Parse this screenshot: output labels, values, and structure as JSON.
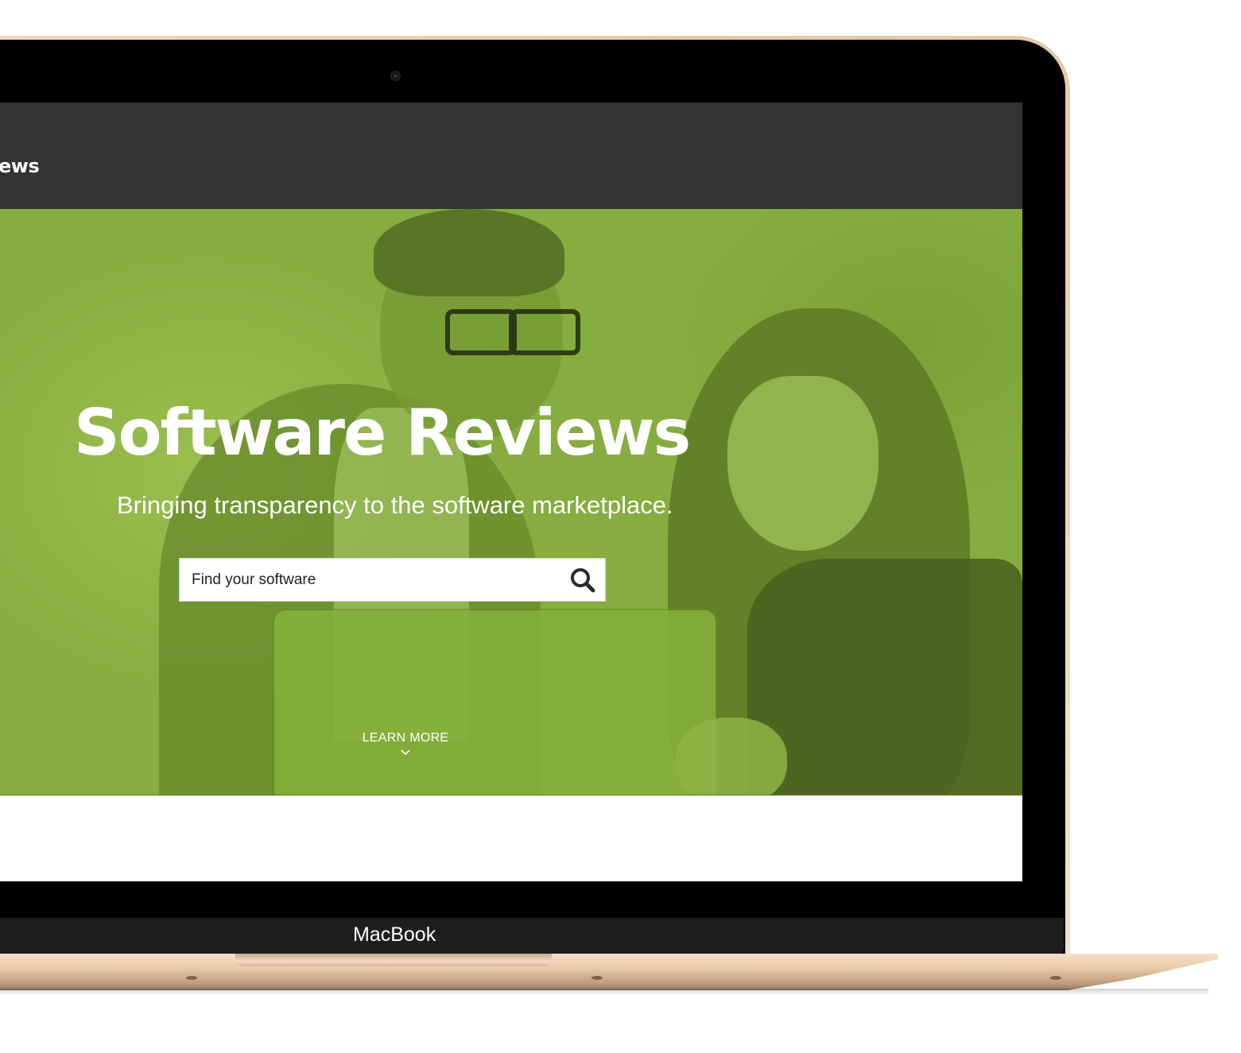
{
  "device": {
    "label": "MacBook"
  },
  "site_header": {
    "brand_fragment": "ews"
  },
  "hero": {
    "title": "Software Reviews",
    "subtitle": "Bringing transparency to the software marketplace.",
    "search": {
      "placeholder": "Find your software",
      "button_icon": "search-icon"
    },
    "learn_more": {
      "label": "LEARN MORE",
      "icon": "chevron-down-icon"
    }
  },
  "colors": {
    "header_bg": "#333333",
    "hero_accent": "#86ad3f",
    "text_on_hero": "#ffffff",
    "device_gold": "#e3c6a2"
  }
}
